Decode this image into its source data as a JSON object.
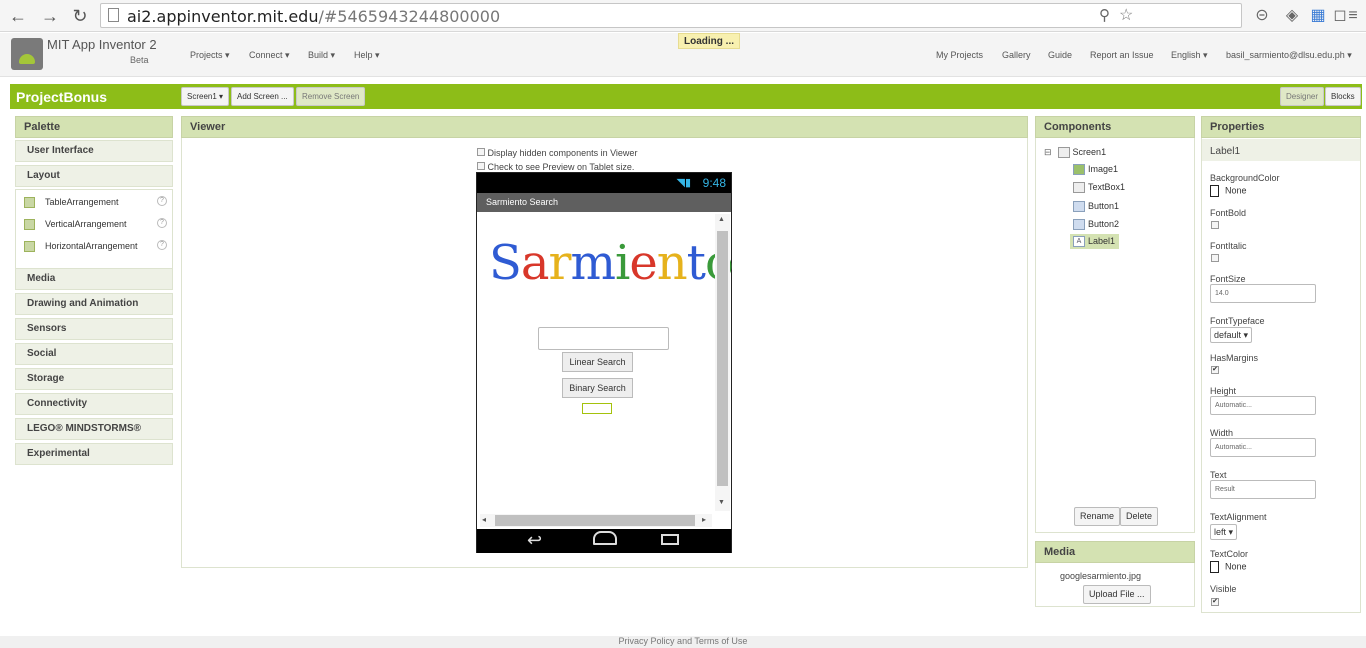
{
  "browser": {
    "url_host": "ai2.appinventor.mit.edu",
    "url_hash": "/#5465943244800000"
  },
  "app": {
    "title": "MIT App Inventor 2",
    "beta": "Beta",
    "loading": "Loading ...",
    "menus": [
      "Projects ▾",
      "Connect ▾",
      "Build ▾",
      "Help ▾"
    ],
    "right_links": [
      "My Projects",
      "Gallery",
      "Guide",
      "Report an Issue",
      "English ▾",
      "basil_sarmiento@dlsu.edu.ph ▾"
    ]
  },
  "project": {
    "name": "ProjectBonus",
    "screen_select": "Screen1 ▾",
    "add_screen": "Add Screen ...",
    "remove_screen": "Remove Screen",
    "designer": "Designer",
    "blocks": "Blocks"
  },
  "palette": {
    "header": "Palette",
    "categories": [
      "User Interface",
      "Layout",
      "Media",
      "Drawing and Animation",
      "Sensors",
      "Social",
      "Storage",
      "Connectivity",
      "LEGO® MINDSTORMS®",
      "Experimental"
    ],
    "layout_items": [
      "TableArrangement",
      "VerticalArrangement",
      "HorizontalArrangement"
    ]
  },
  "viewer": {
    "header": "Viewer",
    "hidden_components": "Display hidden components in Viewer",
    "tablet_preview": "Check to see Preview on Tablet size."
  },
  "phone": {
    "clock": "9:48",
    "app_title": "Sarmiento Search",
    "logo_letters": [
      {
        "ch": "S",
        "color": "#2f5bd3"
      },
      {
        "ch": "a",
        "color": "#d8372a"
      },
      {
        "ch": "r",
        "color": "#e6b21c"
      },
      {
        "ch": "m",
        "color": "#2f5bd3"
      },
      {
        "ch": "i",
        "color": "#3a9a3a"
      },
      {
        "ch": "e",
        "color": "#d8372a"
      },
      {
        "ch": "n",
        "color": "#e6b21c"
      },
      {
        "ch": "t",
        "color": "#2f5bd3"
      },
      {
        "ch": "o",
        "color": "#3a9a3a"
      }
    ],
    "button1": "Linear Search",
    "button2": "Binary Search"
  },
  "components": {
    "header": "Components",
    "tree": [
      "Screen1",
      "Image1",
      "TextBox1",
      "Button1",
      "Button2",
      "Label1"
    ],
    "selected": "Label1",
    "rename": "Rename",
    "delete": "Delete"
  },
  "media": {
    "header": "Media",
    "file": "googlesarmiento.jpg",
    "upload": "Upload File ..."
  },
  "properties": {
    "header": "Properties",
    "component": "Label1",
    "bgcolor_label": "BackgroundColor",
    "bgcolor_value": "None",
    "fontbold_label": "FontBold",
    "fontitalic_label": "FontItalic",
    "fontsize_label": "FontSize",
    "fontsize_value": "14.0",
    "typeface_label": "FontTypeface",
    "typeface_value": "default ▾",
    "hasmargins_label": "HasMargins",
    "height_label": "Height",
    "height_value": "Automatic...",
    "width_label": "Width",
    "width_value": "Automatic...",
    "text_label": "Text",
    "text_value": "Result",
    "align_label": "TextAlignment",
    "align_value": "left ▾",
    "textcolor_label": "TextColor",
    "textcolor_value": "None",
    "visible_label": "Visible",
    "check_mark": "✔"
  },
  "footer": "Privacy Policy and Terms of Use"
}
